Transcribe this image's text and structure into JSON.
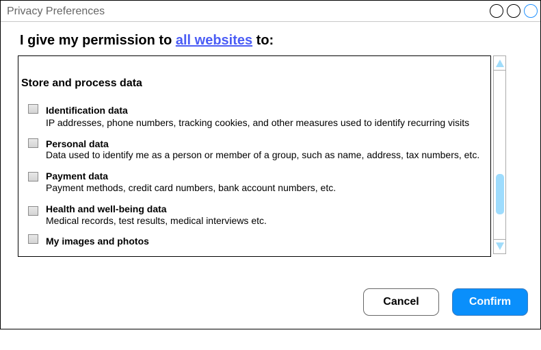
{
  "window": {
    "title": "Privacy Preferences",
    "controls": [
      {
        "name": "window-button-1",
        "color": "#000000"
      },
      {
        "name": "window-button-2",
        "color": "#000000"
      },
      {
        "name": "window-button-3",
        "color": "#1e90ff"
      }
    ]
  },
  "heading": {
    "prefix": "I give my permission to ",
    "link": "all websites",
    "suffix": " to:",
    "link_color": "#4a5cf5"
  },
  "panel": {
    "section_title": "Store and process data",
    "items": [
      {
        "title": "Identification data",
        "description": "IP addresses, phone numbers, tracking cookies, and other measures used to identify recurring visits",
        "checked": false
      },
      {
        "title": "Personal data",
        "description": "Data used to identify me as a person or member of a group, such as name, address, tax numbers, etc.",
        "checked": false
      },
      {
        "title": "Payment data",
        "description": "Payment methods, credit card numbers, bank account numbers, etc.",
        "checked": false
      },
      {
        "title": "Health and well-being data",
        "description": "Medical records, test results, medical interviews etc.",
        "checked": false
      },
      {
        "title": "My images and photos",
        "description": "",
        "checked": false
      }
    ]
  },
  "scrollbar": {
    "up_icon": "triangle-up",
    "down_icon": "triangle-down",
    "scroll_position": "lower-middle",
    "accent_color": "#9edcfd"
  },
  "buttons": {
    "cancel_label": "Cancel",
    "confirm_label": "Confirm",
    "confirm_color": "#0a8ffb"
  }
}
